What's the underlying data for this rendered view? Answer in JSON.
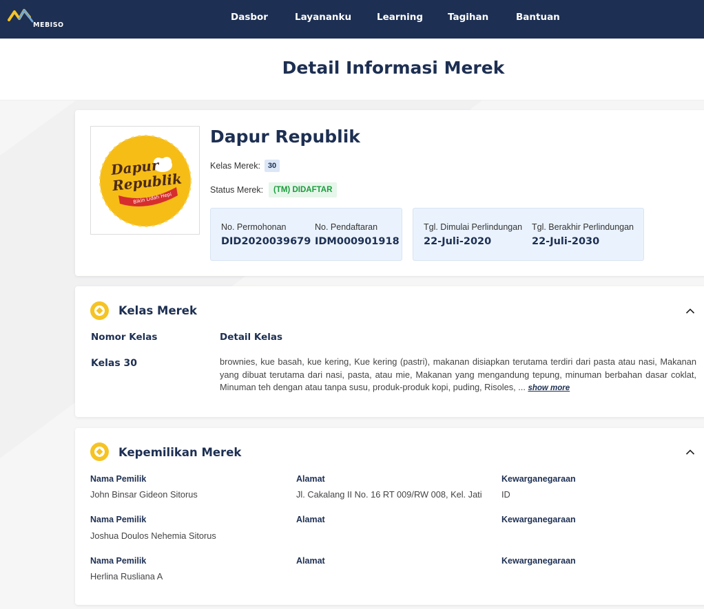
{
  "navbar": {
    "logo_text": "MEBISO",
    "items": [
      "Dasbor",
      "Layananku",
      "Learning",
      "Tagihan",
      "Bantuan"
    ]
  },
  "page": {
    "title": "Detail Informasi Merek"
  },
  "brand": {
    "logo_line1": "Dapur",
    "logo_line2": "Republik",
    "logo_tagline": "Bikin Lidah Hepi",
    "name": "Dapur Republik",
    "kelas_label": "Kelas Merek:",
    "kelas_value": "30",
    "status_label": "Status Merek:",
    "status_value": "(TM) DIDAFTAR",
    "no_permohonan_label": "No. Permohonan",
    "no_permohonan_value": "DID2020039679",
    "no_pendaftaran_label": "No. Pendaftaran",
    "no_pendaftaran_value": "IDM000901918",
    "tgl_mulai_label": "Tgl. Dimulai Perlindungan",
    "tgl_mulai_value": "22-Juli-2020",
    "tgl_berakhir_label": "Tgl. Berakhir Perlindungan",
    "tgl_berakhir_value": "22-Juli-2030"
  },
  "kelas_section": {
    "title": "Kelas Merek",
    "col_nomor": "Nomor Kelas",
    "col_detail": "Detail Kelas",
    "nomor_value": "Kelas 30",
    "detail_value": "brownies, kue basah, kue kering, Kue kering (pastri), makanan disiapkan terutama terdiri dari pasta atau nasi, Makanan yang dibuat terutama dari nasi, pasta, atau mie, Makanan yang mengandung tepung, minuman berbahan dasar coklat, Minuman teh dengan atau tanpa susu, produk-produk kopi, puding, Risoles, ...",
    "show_more": "show more"
  },
  "owner_section": {
    "title": "Kepemilikan Merek",
    "owners": [
      {
        "name_label": "Nama Pemilik",
        "name": "John Binsar Gideon Sitorus",
        "address_label": "Alamat",
        "address": "Jl. Cakalang II No. 16 RT 009/RW 008, Kel. Jati",
        "citizenship_label": "Kewarganegaraan",
        "citizenship": "ID"
      },
      {
        "name_label": "Nama Pemilik",
        "name": "Joshua Doulos Nehemia Sitorus",
        "address_label": "Alamat",
        "address": "",
        "citizenship_label": "Kewarganegaraan",
        "citizenship": ""
      },
      {
        "name_label": "Nama Pemilik",
        "name": "Herlina Rusliana A",
        "address_label": "Alamat",
        "address": "",
        "citizenship_label": "Kewarganegaraan",
        "citizenship": ""
      }
    ]
  },
  "colors": {
    "navy": "#1d2f52",
    "accent_yellow": "#f6c325",
    "status_green": "#1a9b3c",
    "info_box_bg": "#eaf3fd"
  },
  "icons": [
    "mebiso-logo",
    "section-badge-icon",
    "chevron-up-icon"
  ]
}
